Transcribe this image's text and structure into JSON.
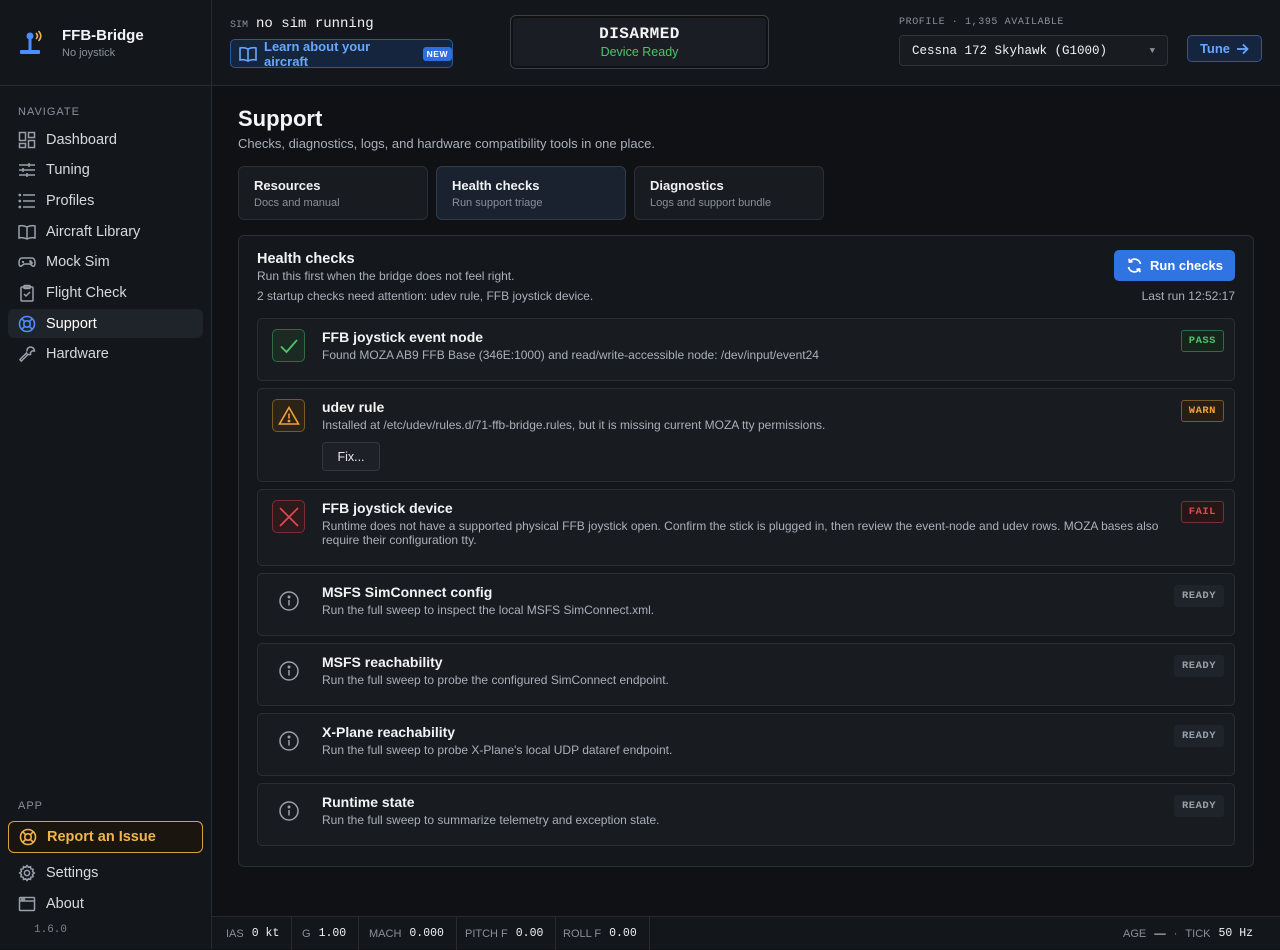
{
  "app": {
    "name": "FFB-Bridge",
    "subtitle": "No joystick",
    "version": "1.6.0"
  },
  "sidebar": {
    "navigate_caption": "NAVIGATE",
    "app_caption": "APP",
    "items": [
      {
        "label": "Dashboard",
        "icon": "dashboard-icon"
      },
      {
        "label": "Tuning",
        "icon": "sliders-icon"
      },
      {
        "label": "Profiles",
        "icon": "list-icon"
      },
      {
        "label": "Aircraft Library",
        "icon": "book-icon"
      },
      {
        "label": "Mock Sim",
        "icon": "gamepad-icon"
      },
      {
        "label": "Flight Check",
        "icon": "clipboard-check-icon"
      },
      {
        "label": "Support",
        "icon": "lifebuoy-icon",
        "active": true
      },
      {
        "label": "Hardware",
        "icon": "wrench-icon"
      }
    ],
    "report_label": "Report an Issue",
    "settings_label": "Settings",
    "about_label": "About"
  },
  "topbar": {
    "sim_label": "SIM",
    "sim_value": "no sim running",
    "learn_label": "Learn about your aircraft",
    "new_badge": "NEW",
    "arm_state": "DISARMED",
    "arm_sub": "Device Ready",
    "profile_caption": "PROFILE · 1,395 AVAILABLE",
    "profile_value": "Cessna 172 Skyhawk (G1000)",
    "tune_label": "Tune"
  },
  "page": {
    "title": "Support",
    "description": "Checks, diagnostics, logs, and hardware compatibility tools in one place.",
    "tabs": [
      {
        "title": "Resources",
        "subtitle": "Docs and manual"
      },
      {
        "title": "Health checks",
        "subtitle": "Run support triage",
        "active": true
      },
      {
        "title": "Diagnostics",
        "subtitle": "Logs and support bundle"
      }
    ]
  },
  "health": {
    "title": "Health checks",
    "subtitle": "Run this first when the bridge does not feel right.",
    "attention": "2 startup checks need attention: udev rule, FFB joystick device.",
    "run_label": "Run checks",
    "last_run": "Last run 12:52:17",
    "fix_label": "Fix...",
    "checks": [
      {
        "title": "FFB joystick event node",
        "desc": "Found MOZA AB9 FFB Base (346E:1000) and read/write-accessible node: /dev/input/event24",
        "status": "PASS"
      },
      {
        "title": "udev rule",
        "desc": "Installed at /etc/udev/rules.d/71-ffb-bridge.rules, but it is missing current MOZA tty permissions.",
        "status": "WARN"
      },
      {
        "title": "FFB joystick device",
        "desc": "Runtime does not have a supported physical FFB joystick open. Confirm the stick is plugged in, then review the event-node and udev rows. MOZA bases also require their configuration tty.",
        "status": "FAIL"
      },
      {
        "title": "MSFS SimConnect config",
        "desc": "Run the full sweep to inspect the local MSFS SimConnect.xml.",
        "status": "READY"
      },
      {
        "title": "MSFS reachability",
        "desc": "Run the full sweep to probe the configured SimConnect endpoint.",
        "status": "READY"
      },
      {
        "title": "X-Plane reachability",
        "desc": "Run the full sweep to probe X-Plane's local UDP dataref endpoint.",
        "status": "READY"
      },
      {
        "title": "Runtime state",
        "desc": "Run the full sweep to summarize telemetry and exception state.",
        "status": "READY"
      }
    ]
  },
  "statusbar": {
    "ias_label": "IAS",
    "ias_value": "0 kt",
    "g_label": "G",
    "g_value": "1.00",
    "mach_label": "MACH",
    "mach_value": "0.000",
    "pitch_label": "PITCH F",
    "pitch_value": "0.00",
    "roll_label": "ROLL F",
    "roll_value": "0.00",
    "age_label": "AGE",
    "age_value": "—",
    "sep": "·",
    "tick_label": "TICK",
    "tick_value": "50 Hz"
  },
  "colors": {
    "accent": "#2f74e0",
    "pass": "#4cc46a",
    "warn": "#f0a23a",
    "fail": "#e5484d",
    "report": "#f0b44a"
  }
}
